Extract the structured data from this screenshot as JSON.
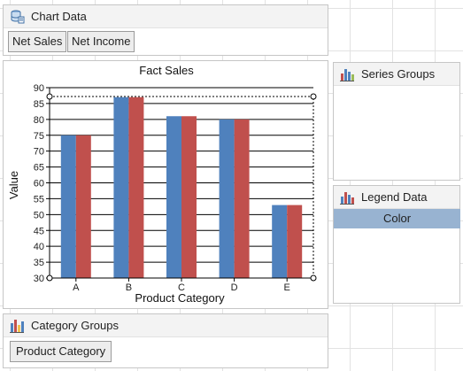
{
  "chart_data_panel": {
    "title": "Chart Data",
    "values": [
      "Net Sales",
      "Net Income"
    ]
  },
  "series_groups_panel": {
    "title": "Series Groups"
  },
  "legend_data_panel": {
    "title": "Legend Data",
    "items": [
      "Color"
    ]
  },
  "category_groups_panel": {
    "title": "Category Groups",
    "items": [
      "Product Category"
    ]
  },
  "colors": {
    "net_sales": "#4f81bd",
    "net_income": "#c0504d"
  },
  "chart_data": {
    "type": "bar",
    "title": "Fact Sales",
    "xlabel": "Product Category",
    "ylabel": "Value",
    "categories": [
      "A",
      "B",
      "C",
      "D",
      "E"
    ],
    "ylim": [
      30,
      90
    ],
    "ytick_step": 5,
    "grid": true,
    "series": [
      {
        "values": [
          75,
          87,
          81,
          80,
          53
        ]
      },
      {
        "values": [
          75,
          87,
          81,
          80,
          53
        ]
      }
    ]
  }
}
